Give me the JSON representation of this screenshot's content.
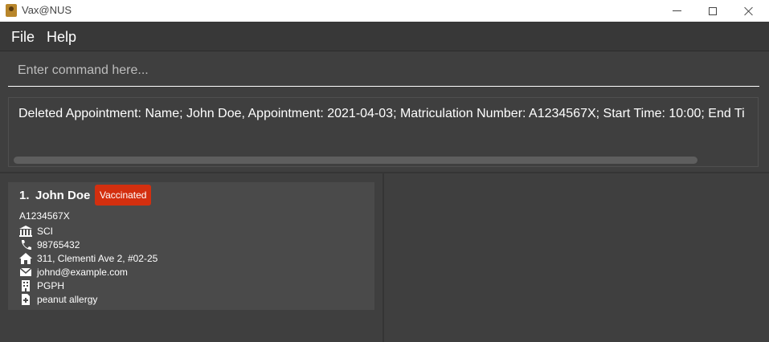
{
  "window": {
    "title": "Vax@NUS"
  },
  "menu": {
    "items": [
      "File",
      "Help"
    ]
  },
  "command": {
    "placeholder": "Enter command here...",
    "value": ""
  },
  "result": {
    "message": "Deleted Appointment: Name; John Doe, Appointment: 2021-04-03; Matriculation Number: A1234567X; Start Time: 10:00; End Ti"
  },
  "students": [
    {
      "index": "1.",
      "name": "John Doe",
      "status": "Vaccinated",
      "matric": "A1234567X",
      "faculty": "SCI",
      "phone": "98765432",
      "address": "311, Clementi Ave 2, #02-25",
      "email": "johnd@example.com",
      "residence": "PGPH",
      "medical": "peanut allergy"
    }
  ],
  "icons": {
    "faculty": "faculty-building-icon",
    "phone": "phone-icon",
    "address": "home-icon",
    "email": "envelope-icon",
    "residence": "residence-building-icon",
    "medical": "medical-document-icon"
  },
  "colors": {
    "background": "#3f3f3f",
    "card": "#4a4a4a",
    "badge": "#d32f0f",
    "text": "#ffffff"
  }
}
